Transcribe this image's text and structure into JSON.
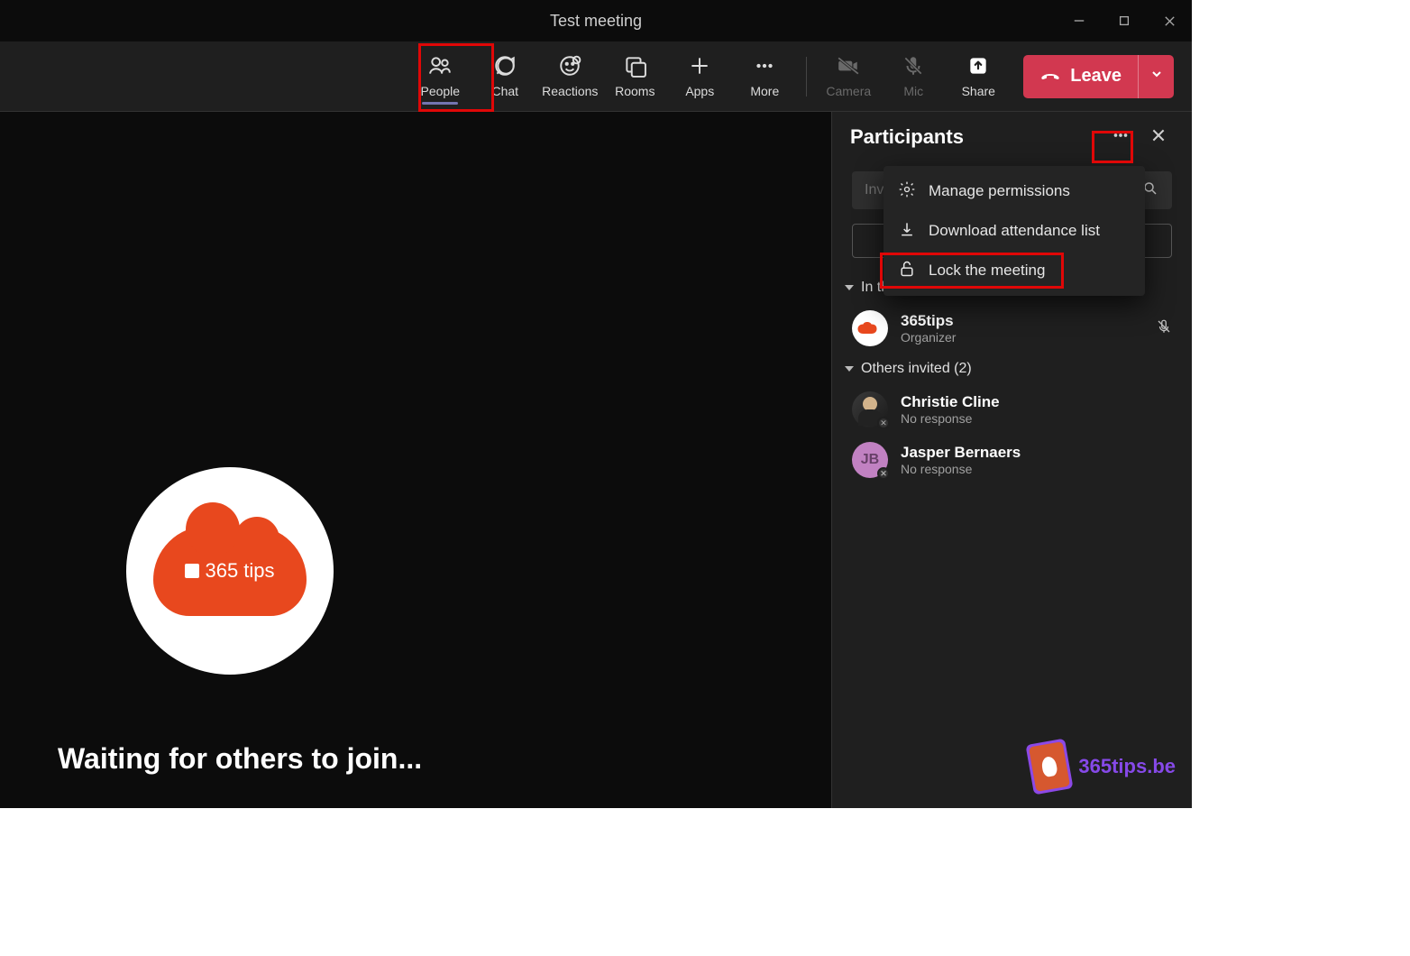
{
  "window": {
    "title": "Test meeting"
  },
  "toolbar": {
    "people": "People",
    "chat": "Chat",
    "reactions": "Reactions",
    "rooms": "Rooms",
    "apps": "Apps",
    "more": "More",
    "camera": "Camera",
    "mic": "Mic",
    "share": "Share",
    "leave": "Leave"
  },
  "stage": {
    "avatar_logo_text": "365 tips",
    "waiting_text": "Waiting for others to join..."
  },
  "panel": {
    "title": "Participants",
    "search_placeholder": "Invite someone",
    "menu": {
      "manage_permissions": "Manage permissions",
      "download_attendance": "Download attendance list",
      "lock_meeting": "Lock the meeting"
    },
    "section_in_meeting": "In this meeting (1)",
    "section_others": "Others invited (2)",
    "participants_in_meeting": [
      {
        "name": "365tips",
        "role": "Organizer",
        "avatar_type": "logo"
      }
    ],
    "participants_invited": [
      {
        "name": "Christie Cline",
        "status": "No response",
        "avatar_type": "photo"
      },
      {
        "name": "Jasper Bernaers",
        "status": "No response",
        "avatar_type": "initials",
        "initials": "JB"
      }
    ]
  },
  "watermark": {
    "text": "365tips.be"
  },
  "colors": {
    "accent_red": "#d23850",
    "highlight": "#e00707",
    "logo_orange": "#e8481e",
    "wm_purple": "#8649e8"
  }
}
